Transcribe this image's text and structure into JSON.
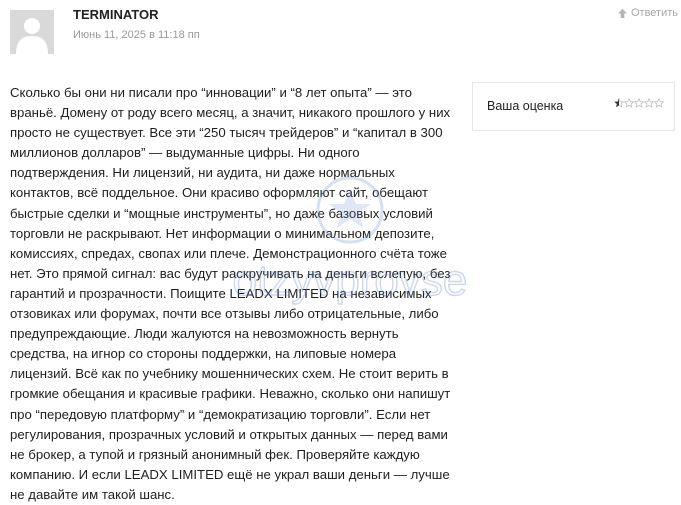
{
  "comment": {
    "author": "TERMINATOR",
    "date": "Июнь 11, 2025 в 11:18 пп",
    "reply_label": "Ответить",
    "avatar_icon": "user-silhouette-icon",
    "text": "Сколько бы они ни писали про “инновации” и “8 лет опыта” — это враньё. Домену от роду всего месяц, а значит, никакого прошлого у них просто не существует. Все эти “250 тысяч трейдеров” и “капитал в 300 миллионов долларов” — выдуманные цифры. Ни одного подтверждения. Ни лицензий, ни аудита, ни даже нормальных контактов, всё поддельное. Они красиво оформляют сайт, обещают быстрые сделки и “мощные инструменты”, но даже базовых условий торговли не раскрывают. Нет информации о минимальном депозите, комиссиях, спредах, свопах или плече. Демонстрационного счёта тоже нет. Это прямой сигнал: вас будут раскручивать на деньги вслепую, без гарантий и прозрачности. Поищите LEADX LIMITED на независимых отзовиках или форумах, почти все отзывы либо отрицательные, либо предупреждающие. Люди жалуются на невозможность вернуть средства, на игнор со стороны поддержки, на липовые номера лицензий. Всё как по учебнику мошеннических схем. Не стоит верить в громкие обещания и красивые графики. Неважно, сколько они напишут про “передовую платформу” и “демократизацию торговли”. Если нет регулирования, прозрачных условий и открытых данных — перед вами не брокер, а тупой и грязный анонимный фек. Проверяйте каждую компанию. И если LEADX LIMITED ещё не украл ваши деньги — лучше не давайте им такой шанс."
  },
  "rating": {
    "label": "Ваша оценка",
    "value": 0.5,
    "max": 5,
    "star_color": "#333333",
    "empty_star_color": "#bbbbbb"
  },
  "watermark": {
    "text": "otzyvprovse",
    "color": "#6d8fd1"
  }
}
